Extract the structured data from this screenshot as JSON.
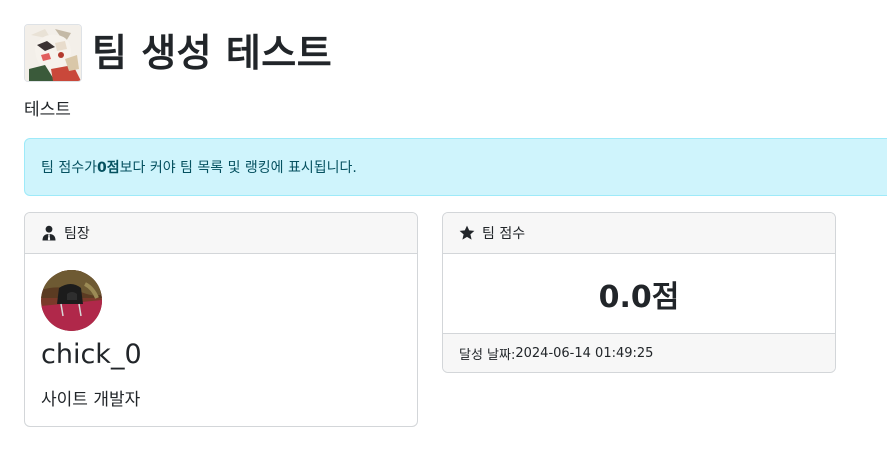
{
  "team": {
    "title": "팀 생성 테스트",
    "description": "테스트"
  },
  "alert": {
    "prefix": "팀 점수가 ",
    "threshold": "0점",
    "suffix": "보다 커야 팀 목록 및 랭킹에 표시됩니다."
  },
  "leader_card": {
    "header_icon": "user-tie-icon",
    "header_label": "팀장",
    "name": "chick_0",
    "role": "사이트 개발자"
  },
  "score_card": {
    "header_icon": "star-icon",
    "header_label": "팀 점수",
    "score": "0.0점",
    "achieved_label": "달성 날짜: ",
    "achieved_date": "2024-06-14 01:49:25"
  },
  "colors": {
    "alert_bg": "#cff4fc",
    "alert_text": "#055160",
    "card_header_bg": "#f7f7f7"
  }
}
